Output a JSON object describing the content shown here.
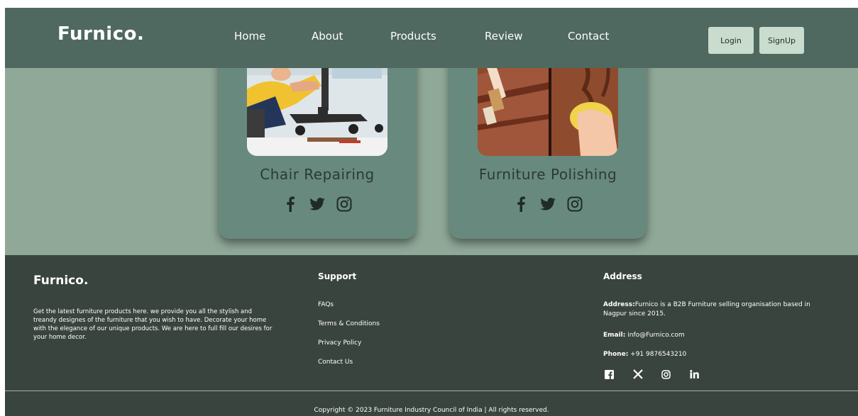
{
  "navbar": {
    "brand": "Furnico.",
    "links": [
      "Home",
      "About",
      "Products",
      "Review",
      "Contact"
    ],
    "login_label": "Login",
    "signup_label": "SignUp"
  },
  "services": {
    "cards": [
      {
        "title": "Chair Repairing",
        "social": [
          "facebook-icon",
          "twitter-icon",
          "instagram-icon"
        ]
      },
      {
        "title": "Furniture Polishing",
        "social": [
          "facebook-icon",
          "twitter-icon",
          "instagram-icon"
        ]
      }
    ]
  },
  "footer": {
    "brand": "Furnico.",
    "description": "Get the latest furniture products here. we provide you all the stylish and treandy designes of the furniture that you wish to have. Decorate your home with the elegance of our unique products. We are here to full fill our desires for your home decor.",
    "support_heading": "Support",
    "support_links": [
      "FAQs",
      "Terms & Conditions",
      "Privacy Policy",
      "Contact Us"
    ],
    "address_heading": "Address",
    "address_label": "Address:",
    "address_text": "Furnico is a B2B Furniture selling organisation based in Nagpur since 2015.",
    "email_label": "Email:",
    "email_value": " info@Furnico.com",
    "phone_label": "Phone:",
    "phone_value": " +91 9876543210",
    "social_icons": [
      "facebook-icon",
      "x-icon",
      "instagram-icon",
      "linkedin-icon"
    ],
    "copyright": "Copyright © 2023 Furniture Industry Council of India | All rights reserved."
  },
  "colors": {
    "navbar_bg": "#4f6860",
    "services_bg": "#8fa898",
    "card_bg": "#688a7e",
    "footer_bg": "#3a443f",
    "button_bg": "#c9dccd"
  }
}
